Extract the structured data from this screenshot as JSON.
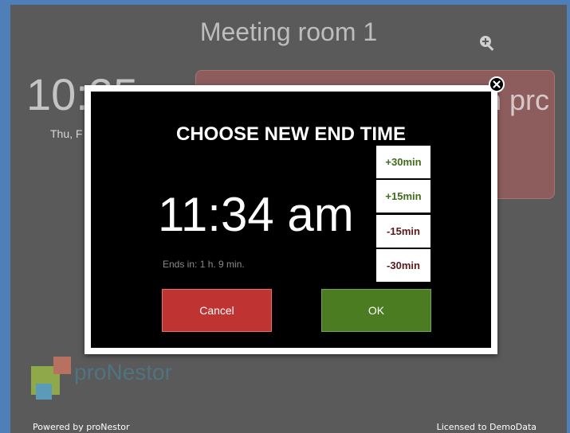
{
  "room": {
    "title": "Meeting room 1"
  },
  "clock": {
    "time": "10:25 am",
    "date": "Thu, F"
  },
  "status_card": {
    "text": "n prc"
  },
  "branding": {
    "logo_text": "proNestor",
    "powered_by": "Powered by proNestor",
    "licensed_to": "Licensed to DemoData"
  },
  "icons": {
    "zoom": "zoom-in-icon",
    "close": "close-circle-icon"
  },
  "modal": {
    "title": "CHOOSE NEW END TIME",
    "new_time": "11:34 am",
    "ends_in": "Ends in:  1  h.  9 min.",
    "adjust_buttons": [
      "+30min",
      "+15min",
      "-15min",
      "-30min"
    ],
    "cancel_label": "Cancel",
    "ok_label": "OK"
  },
  "colors": {
    "background": "#5a5a5a",
    "frame": "#4f7fb8",
    "status_card": "#8d5d5d",
    "cancel": "#c03333",
    "ok": "#4c7c22",
    "plus_text": "#3f6b1b",
    "minus_text": "#5a1a1a"
  }
}
